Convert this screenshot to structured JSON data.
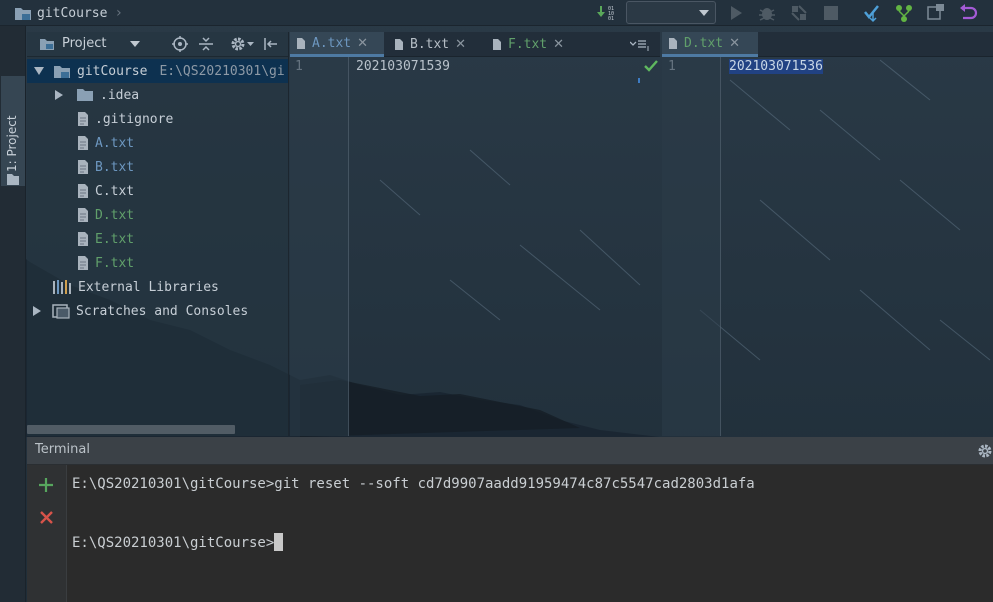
{
  "breadcrumb": {
    "project": "gitCourse"
  },
  "toolbar": {
    "run_config_value": "",
    "icons": [
      "git-update-icon",
      "run-icon",
      "debug-icon",
      "coverage-icon",
      "stop-icon",
      "vcs-update-icon",
      "vcs-commit-icon",
      "vcs-branch-icon",
      "vcs-revert-icon"
    ]
  },
  "left_stripe": {
    "project_tab": "1: Project"
  },
  "project_panel": {
    "title": "Project",
    "tree": {
      "root_label": "gitCourse",
      "root_path": "E:\\QS20210301\\gi",
      "items": [
        {
          "label": ".idea",
          "type": "folder",
          "status": "default"
        },
        {
          "label": ".gitignore",
          "type": "file",
          "status": "default"
        },
        {
          "label": "A.txt",
          "type": "file",
          "status": "modified"
        },
        {
          "label": "B.txt",
          "type": "file",
          "status": "modified"
        },
        {
          "label": "C.txt",
          "type": "file",
          "status": "default"
        },
        {
          "label": "D.txt",
          "type": "file",
          "status": "added"
        },
        {
          "label": "E.txt",
          "type": "file",
          "status": "added"
        },
        {
          "label": "F.txt",
          "type": "file",
          "status": "added"
        }
      ],
      "external_libraries": "External Libraries",
      "scratches": "Scratches and Consoles"
    }
  },
  "left_editor": {
    "tabs": [
      {
        "label": "A.txt",
        "status": "modified"
      },
      {
        "label": "B.txt",
        "status": "default"
      },
      {
        "label": "F.txt",
        "status": "added"
      }
    ],
    "line_number": "1",
    "content": "202103071539"
  },
  "right_editor": {
    "tab": {
      "label": "D.txt",
      "status": "added"
    },
    "line_number": "1",
    "content": "202103071536"
  },
  "terminal": {
    "title": "Terminal",
    "lines": [
      "E:\\QS20210301\\gitCourse>git reset --soft cd7d9907aadd91959474c87c5547cad2803d1afa",
      "E:\\QS20210301\\gitCourse>"
    ]
  },
  "colors": {
    "modified": "#6d97c0",
    "added": "#61a06b",
    "selection": "#0d3150",
    "text_selection": "#214283"
  }
}
